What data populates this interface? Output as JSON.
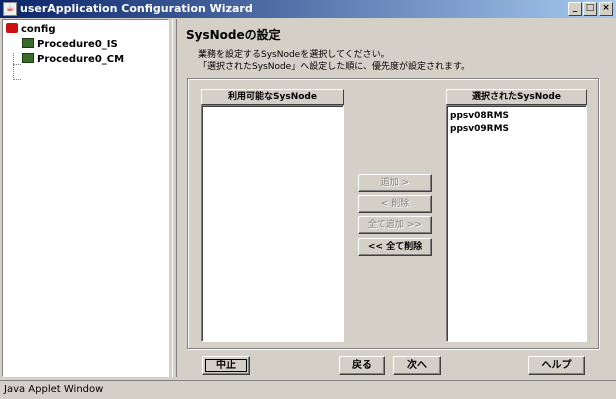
{
  "window": {
    "title": "userApplication Configuration Wizard",
    "controls": {
      "minimize": "_",
      "maximize": "□",
      "close": "×"
    }
  },
  "tree": {
    "root": {
      "label": "config",
      "icon": "config-icon"
    },
    "children": [
      {
        "label": "Procedure0_IS",
        "icon": "procedure-icon"
      },
      {
        "label": "Procedure0_CM",
        "icon": "procedure-icon"
      }
    ]
  },
  "panel": {
    "title": "SysNodeの設定",
    "description": [
      "業務を設定するSysNodeを選択してください。",
      "「選択されたSysNode」へ設定した順に、優先度が設定されます。"
    ]
  },
  "available_list": {
    "header": "利用可能なSysNode",
    "items": []
  },
  "selected_list": {
    "header": "選択されたSysNode",
    "items": [
      "ppsv08RMS",
      "ppsv09RMS"
    ]
  },
  "transfer_buttons": {
    "add": "追加 >",
    "remove": "< 削除",
    "add_all": "全て追加 >>",
    "remove_all": "<< 全て削除"
  },
  "footer_buttons": {
    "cancel": "中止",
    "back": "戻る",
    "next": "次へ",
    "help": "ヘルプ"
  },
  "status": {
    "text": "Java Applet Window"
  }
}
